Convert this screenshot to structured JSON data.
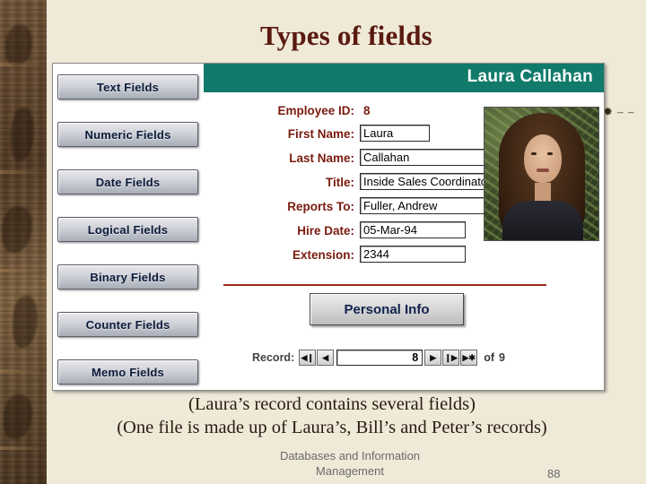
{
  "slide": {
    "title": "Types of fields",
    "caption1": "(Laura’s record contains several fields)",
    "caption2": "(One file is made up of Laura’s, Bill’s and Peter’s records)",
    "footer_line1": "Databases and Information",
    "footer_line2": "Management",
    "page_number": "88",
    "right_marks": "✹ – –"
  },
  "field_buttons": [
    {
      "label": "Text Fields"
    },
    {
      "label": "Numeric Fields"
    },
    {
      "label": "Date Fields"
    },
    {
      "label": "Logical Fields"
    },
    {
      "label": "Binary Fields"
    },
    {
      "label": "Counter Fields"
    },
    {
      "label": "Memo Fields"
    }
  ],
  "form": {
    "header_title": "Laura Callahan",
    "employee_id_label": "Employee ID:",
    "employee_id_value": "8",
    "fields": [
      {
        "label": "First Name:",
        "value": "Laura"
      },
      {
        "label": "Last Name:",
        "value": "Callahan"
      },
      {
        "label": "Title:",
        "value": "Inside Sales Coordinator"
      },
      {
        "label": "Reports To:",
        "value": "Fuller, Andrew"
      },
      {
        "label": "Hire Date:",
        "value": "05-Mar-94"
      },
      {
        "label": "Extension:",
        "value": "2344"
      }
    ],
    "personal_info_button": "Personal Info",
    "record_bar": {
      "label": "Record:",
      "first_glyph": "◀❙",
      "prev_glyph": "◀",
      "current": "8",
      "next_glyph": "▶",
      "last_glyph": "❙▶",
      "new_glyph": "▶✱",
      "of_label": "of",
      "total": "9"
    },
    "combo_arrow_glyph": "▼",
    "photo_alt": "employee-photo"
  },
  "colors": {
    "slide_background": "#efe9d8",
    "title_text": "#5a1a10",
    "form_header": "#117a6b",
    "form_label": "#7a1b0f",
    "divider": "#a02b1c"
  }
}
